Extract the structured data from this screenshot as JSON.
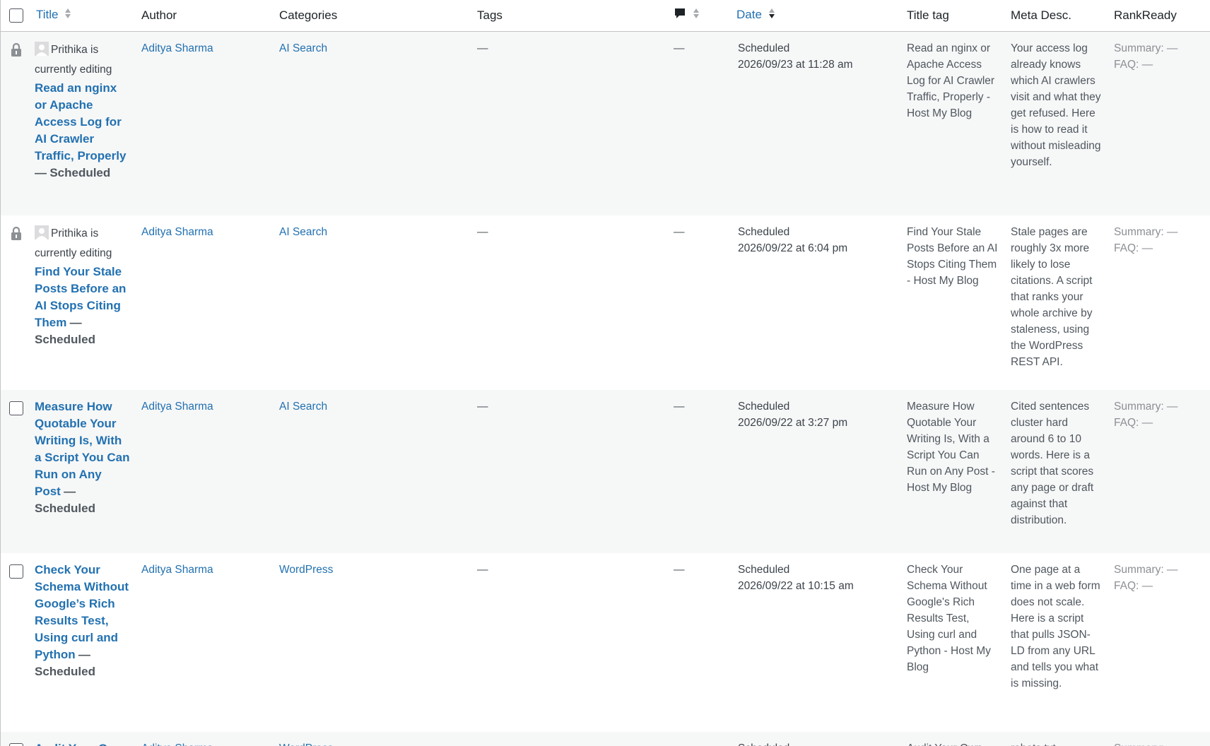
{
  "columns": {
    "title": "Title",
    "author": "Author",
    "categories": "Categories",
    "tags": "Tags",
    "comments_icon": "comment-bubble-icon",
    "date": "Date",
    "title_tag": "Title tag",
    "meta_desc": "Meta Desc.",
    "rankready": "RankReady"
  },
  "colors": {
    "link": "#2271b1",
    "row_alt": "#f6f7f7",
    "border": "#c3c4c7"
  },
  "rows": [
    {
      "locked": true,
      "editing_user": "Prithika",
      "editing_suffix": "is currently editing",
      "title": "Read an nginx or Apache Access Log for AI Crawler Traffic, Properly",
      "sep": "—",
      "state": "Scheduled",
      "author": "Aditya Sharma",
      "category": "AI Search",
      "tags": "—",
      "comments": "—",
      "date_status": "Scheduled",
      "date_value": "2026/09/23 at 11:28 am",
      "title_tag": "Read an nginx or Apache Access Log for AI Crawler Traffic, Properly - Host My Blog",
      "meta_desc": "Your access log already knows which AI crawlers visit and what they get refused. Here is how to read it without misleading yourself.",
      "summary": "Summary: —",
      "faq": "FAQ: —"
    },
    {
      "locked": true,
      "editing_user": "Prithika",
      "editing_suffix": "is currently editing",
      "title": "Find Your Stale Posts Before an AI Stops Citing Them",
      "sep": "—",
      "state": "Scheduled",
      "author": "Aditya Sharma",
      "category": "AI Search",
      "tags": "—",
      "comments": "—",
      "date_status": "Scheduled",
      "date_value": "2026/09/22 at 6:04 pm",
      "title_tag": "Find Your Stale Posts Before an AI Stops Citing Them - Host My Blog",
      "meta_desc": "Stale pages are roughly 3x more likely to lose citations. A script that ranks your whole archive by staleness, using the WordPress REST API.",
      "summary": "Summary: —",
      "faq": "FAQ: —"
    },
    {
      "locked": false,
      "title": "Measure How Quotable Your Writing Is, With a Script You Can Run on Any Post",
      "sep": "—",
      "state": "Scheduled",
      "author": "Aditya Sharma",
      "category": "AI Search",
      "tags": "—",
      "comments": "—",
      "date_status": "Scheduled",
      "date_value": "2026/09/22 at 3:27 pm",
      "title_tag": "Measure How Quotable Your Writing Is, With a Script You Can Run on Any Post - Host My Blog",
      "meta_desc": "Cited sentences cluster hard around 6 to 10 words. Here is a script that scores any page or draft against that distribution.",
      "summary": "Summary: —",
      "faq": "FAQ: —"
    },
    {
      "locked": false,
      "title": "Check Your Schema Without Google’s Rich Results Test, Using curl and Python",
      "sep": "—",
      "state": "Scheduled",
      "author": "Aditya Sharma",
      "category": "WordPress",
      "tags": "—",
      "comments": "—",
      "date_status": "Scheduled",
      "date_value": "2026/09/22 at 10:15 am",
      "title_tag": "Check Your Schema Without Google's Rich Results Test, Using curl and Python - Host My Blog",
      "meta_desc": "One page at a time in a web form does not scale. Here is a script that pulls JSON-LD from any URL and tells you what is missing.",
      "summary": "Summary: —",
      "faq": "FAQ: —"
    },
    {
      "locked": false,
      "title": "Audit Your Own",
      "sep": "",
      "state": "",
      "author": "Aditya Sharma",
      "category": "WordPress",
      "tags": "",
      "comments": "",
      "date_status": "Scheduled",
      "date_value": "",
      "title_tag": "Audit Your Own",
      "meta_desc": "robots.txt",
      "summary": "Summary:",
      "faq": ""
    }
  ]
}
